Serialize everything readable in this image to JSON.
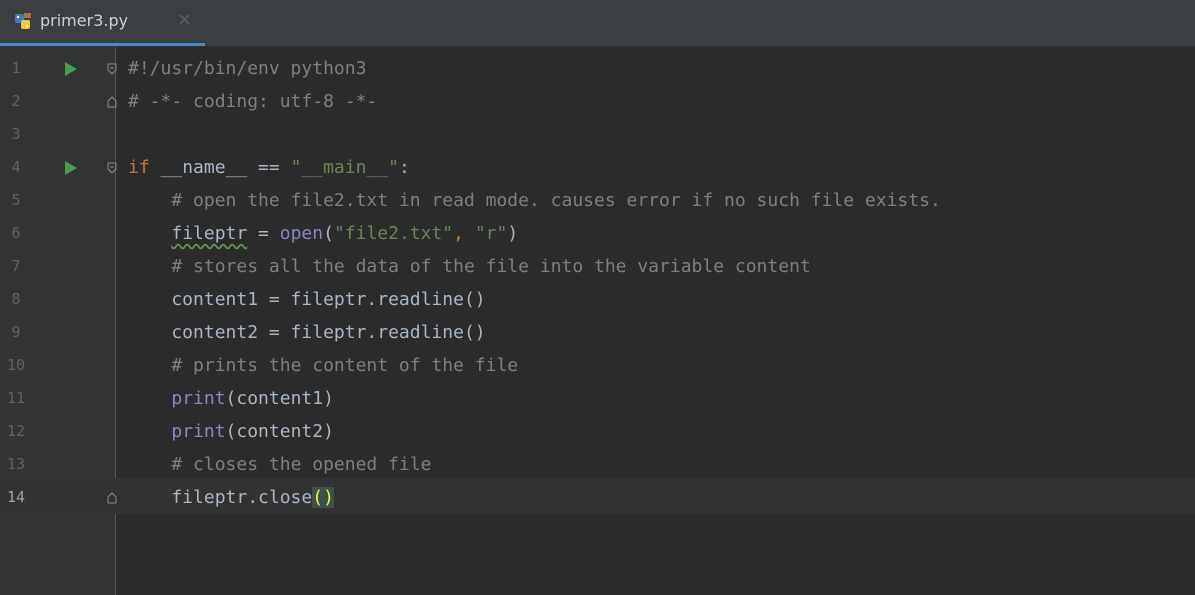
{
  "tab": {
    "label": "primer3.py",
    "close_glyph": "×",
    "icon": "python-file-icon"
  },
  "editor": {
    "current_line": 14,
    "lines": [
      {
        "n": "1",
        "text": "#!/usr/bin/env python3",
        "run": true,
        "fold": "start"
      },
      {
        "n": "2",
        "text": "# -*- coding: utf-8 -*-",
        "run": false,
        "fold": "end"
      },
      {
        "n": "3",
        "text": "",
        "run": false,
        "fold": ""
      },
      {
        "n": "4",
        "text": "if __name__ == \"__main__\":",
        "run": true,
        "fold": "start"
      },
      {
        "n": "5",
        "text": "    # open the file2.txt in read mode. causes error if no such file exists.",
        "run": false,
        "fold": ""
      },
      {
        "n": "6",
        "text": "    fileptr = open(\"file2.txt\", \"r\")",
        "run": false,
        "fold": ""
      },
      {
        "n": "7",
        "text": "    # stores all the data of the file into the variable content",
        "run": false,
        "fold": ""
      },
      {
        "n": "8",
        "text": "    content1 = fileptr.readline()",
        "run": false,
        "fold": ""
      },
      {
        "n": "9",
        "text": "    content2 = fileptr.readline()",
        "run": false,
        "fold": ""
      },
      {
        "n": "10",
        "text": "    # prints the content of the file",
        "run": false,
        "fold": ""
      },
      {
        "n": "11",
        "text": "    print(content1)",
        "run": false,
        "fold": ""
      },
      {
        "n": "12",
        "text": "    print(content2)",
        "run": false,
        "fold": ""
      },
      {
        "n": "13",
        "text": "    # closes the opened file",
        "run": false,
        "fold": ""
      },
      {
        "n": "14",
        "text": "    fileptr.close()",
        "run": false,
        "fold": "end"
      }
    ]
  },
  "colors": {
    "background": "#2b2b2b",
    "gutter": "#313335",
    "keyword": "#cc7832",
    "comment": "#808080",
    "string": "#6a8759",
    "builtin": "#8888c6",
    "text": "#a9b7c6",
    "run_icon": "#499c54",
    "tab_underline": "#4a88c7"
  }
}
